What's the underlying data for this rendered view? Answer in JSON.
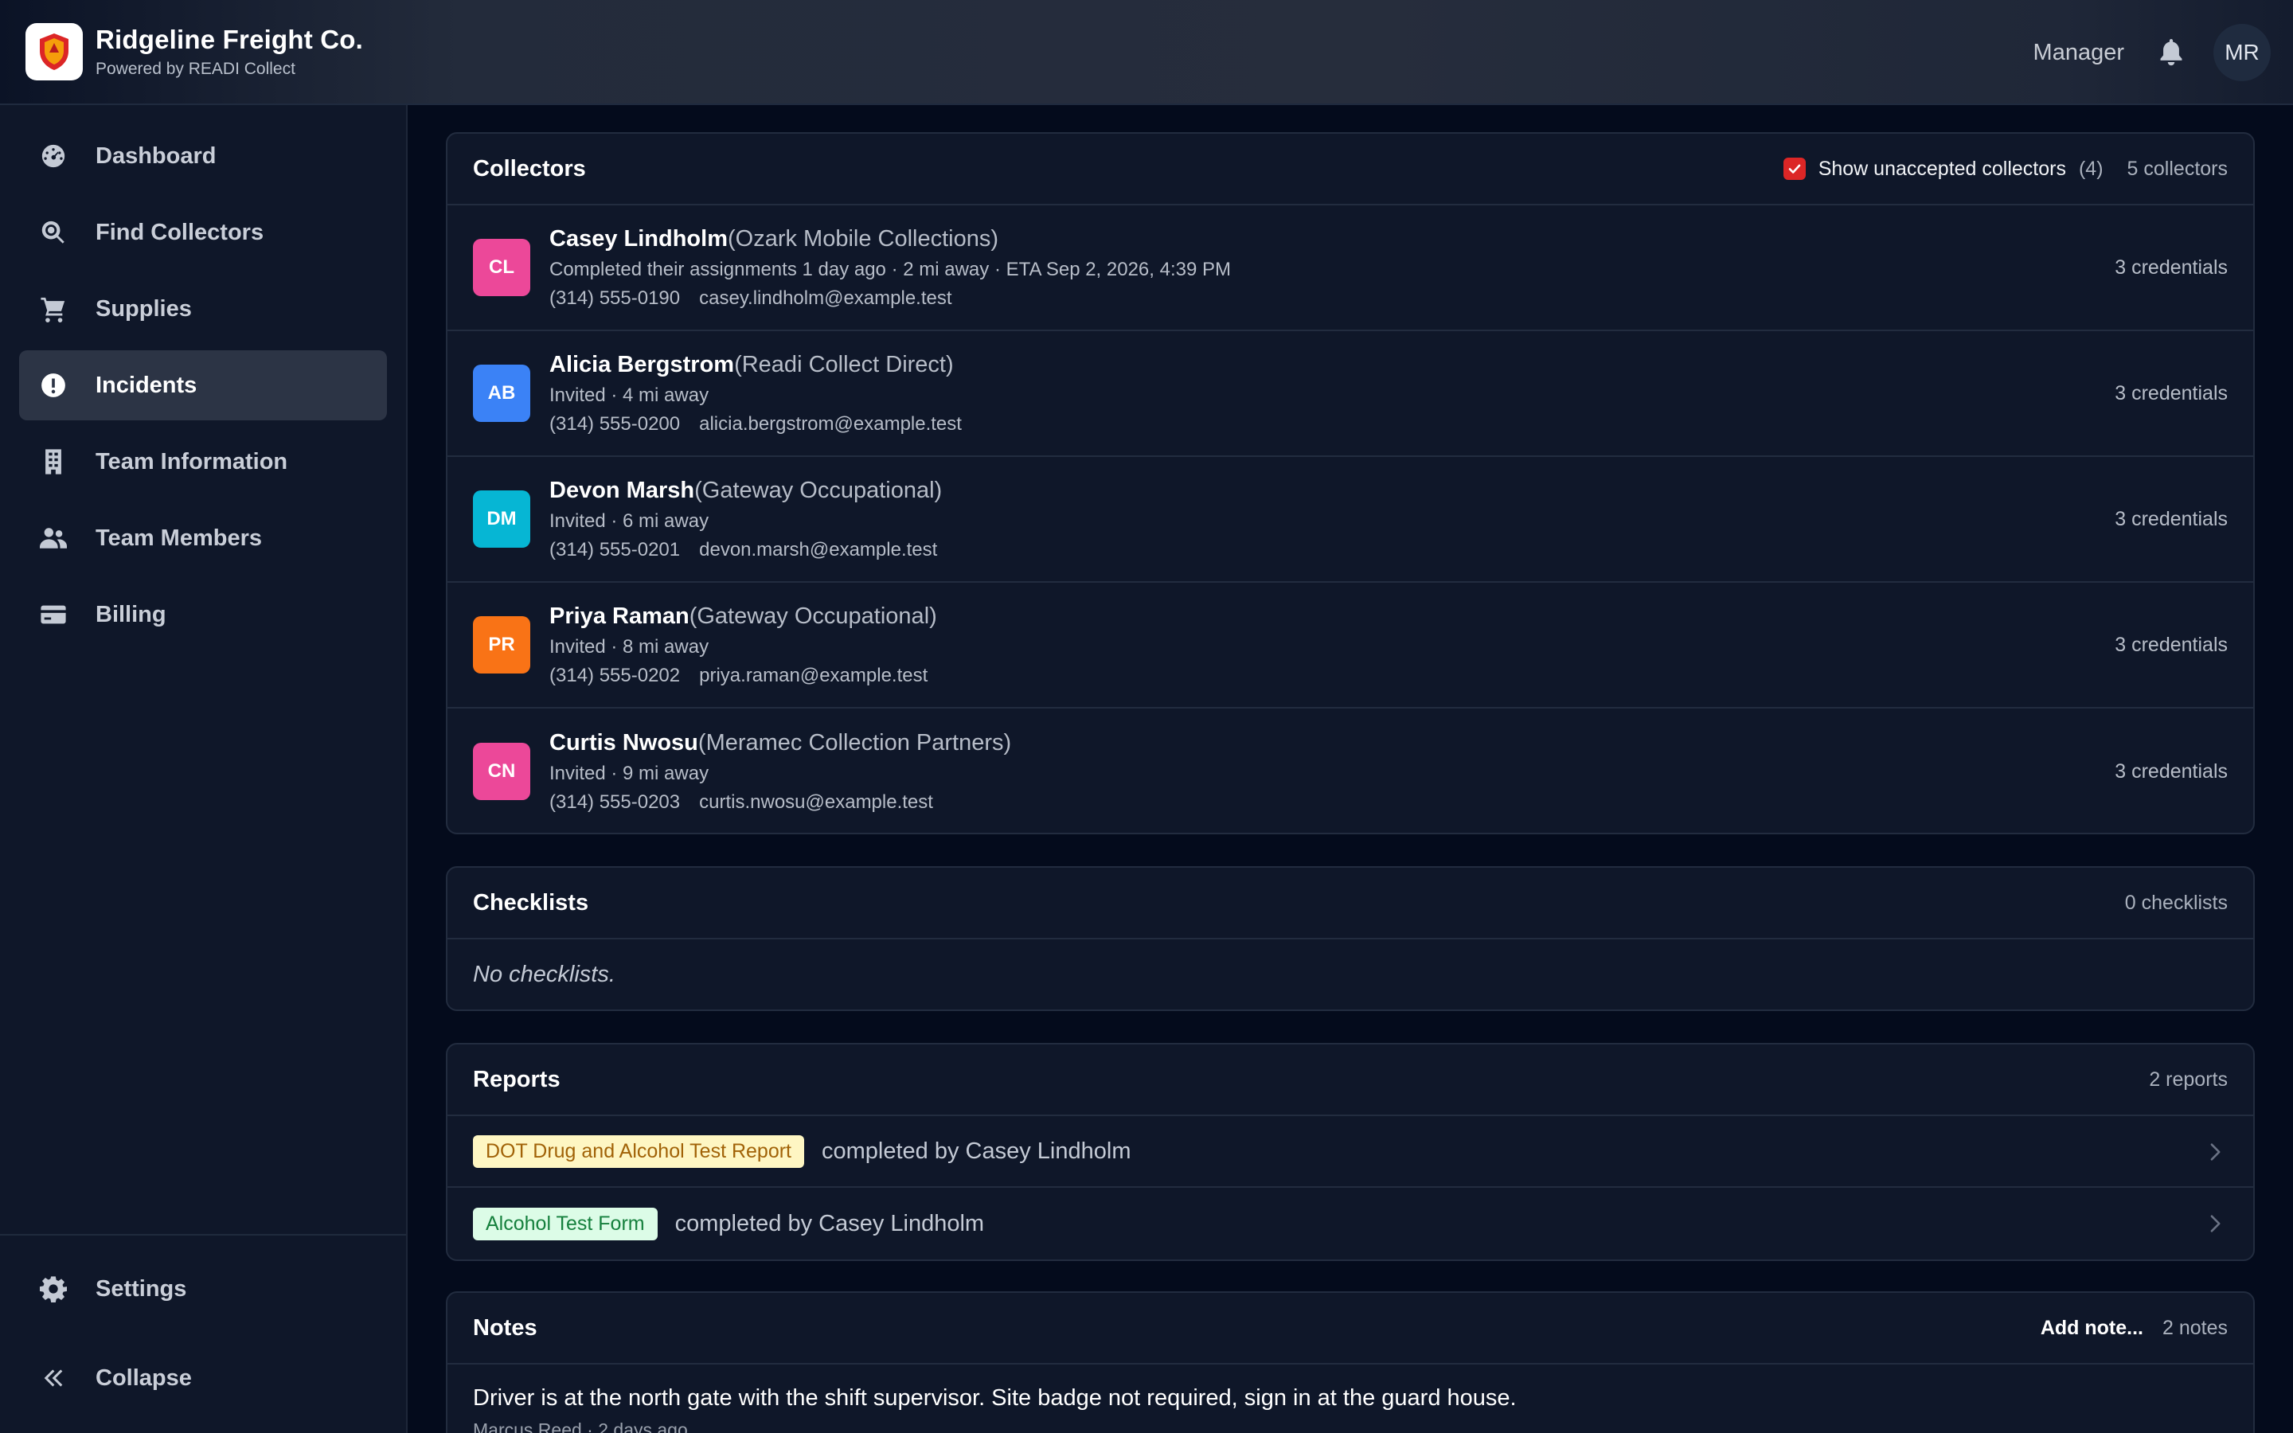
{
  "header": {
    "brand_name": "Ridgeline Freight Co.",
    "brand_sub": "Powered by READI Collect",
    "role": "Manager",
    "avatar_initials": "MR"
  },
  "sidebar": {
    "items": [
      {
        "label": "Dashboard",
        "icon": "gauge-icon"
      },
      {
        "label": "Find Collectors",
        "icon": "magnifier-icon"
      },
      {
        "label": "Supplies",
        "icon": "cart-icon"
      },
      {
        "label": "Incidents",
        "icon": "alert-icon",
        "active": true
      },
      {
        "label": "Team Information",
        "icon": "building-icon"
      },
      {
        "label": "Team Members",
        "icon": "users-icon"
      },
      {
        "label": "Billing",
        "icon": "credit-card-icon"
      }
    ],
    "settings_label": "Settings",
    "collapse_label": "Collapse"
  },
  "collectors": {
    "title": "Collectors",
    "show_unaccepted_label": "Show unaccepted collectors",
    "unaccepted_count": "(4)",
    "count_label": "5 collectors",
    "rows": [
      {
        "initials": "CL",
        "color": "#ec4899",
        "name": "Casey Lindholm",
        "org": "(Ozark Mobile Collections)",
        "status": "Completed their assignments 1 day ago · 2 mi away · ETA Sep 2, 2026, 4:39 PM",
        "phone": "(314) 555-0190",
        "email": "casey.lindholm@example.test",
        "credentials": "3 credentials"
      },
      {
        "initials": "AB",
        "color": "#3b82f6",
        "name": "Alicia Bergstrom",
        "org": "(Readi Collect Direct)",
        "status": "Invited · 4 mi away",
        "phone": "(314) 555-0200",
        "email": "alicia.bergstrom@example.test",
        "credentials": "3 credentials"
      },
      {
        "initials": "DM",
        "color": "#06b6d4",
        "name": "Devon Marsh",
        "org": "(Gateway Occupational)",
        "status": "Invited · 6 mi away",
        "phone": "(314) 555-0201",
        "email": "devon.marsh@example.test",
        "credentials": "3 credentials"
      },
      {
        "initials": "PR",
        "color": "#f97316",
        "name": "Priya Raman",
        "org": "(Gateway Occupational)",
        "status": "Invited · 8 mi away",
        "phone": "(314) 555-0202",
        "email": "priya.raman@example.test",
        "credentials": "3 credentials"
      },
      {
        "initials": "CN",
        "color": "#ec4899",
        "name": "Curtis Nwosu",
        "org": "(Meramec Collection Partners)",
        "status": "Invited · 9 mi away",
        "phone": "(314) 555-0203",
        "email": "curtis.nwosu@example.test",
        "credentials": "3 credentials"
      }
    ]
  },
  "checklists": {
    "title": "Checklists",
    "count_label": "0 checklists",
    "empty": "No checklists."
  },
  "reports": {
    "title": "Reports",
    "count_label": "2 reports",
    "rows": [
      {
        "badge": "DOT Drug and Alcohol Test Report",
        "badge_color": "yellow",
        "text": "completed by Casey Lindholm"
      },
      {
        "badge": "Alcohol Test Form",
        "badge_color": "green",
        "text": "completed by Casey Lindholm"
      }
    ]
  },
  "notes": {
    "title": "Notes",
    "add_label": "Add note...",
    "count_label": "2 notes",
    "first_note": {
      "text": "Driver is at the north gate with the shift supervisor. Site badge not required, sign in at the guard house.",
      "meta": "Marcus Reed · 2 days ago"
    }
  }
}
